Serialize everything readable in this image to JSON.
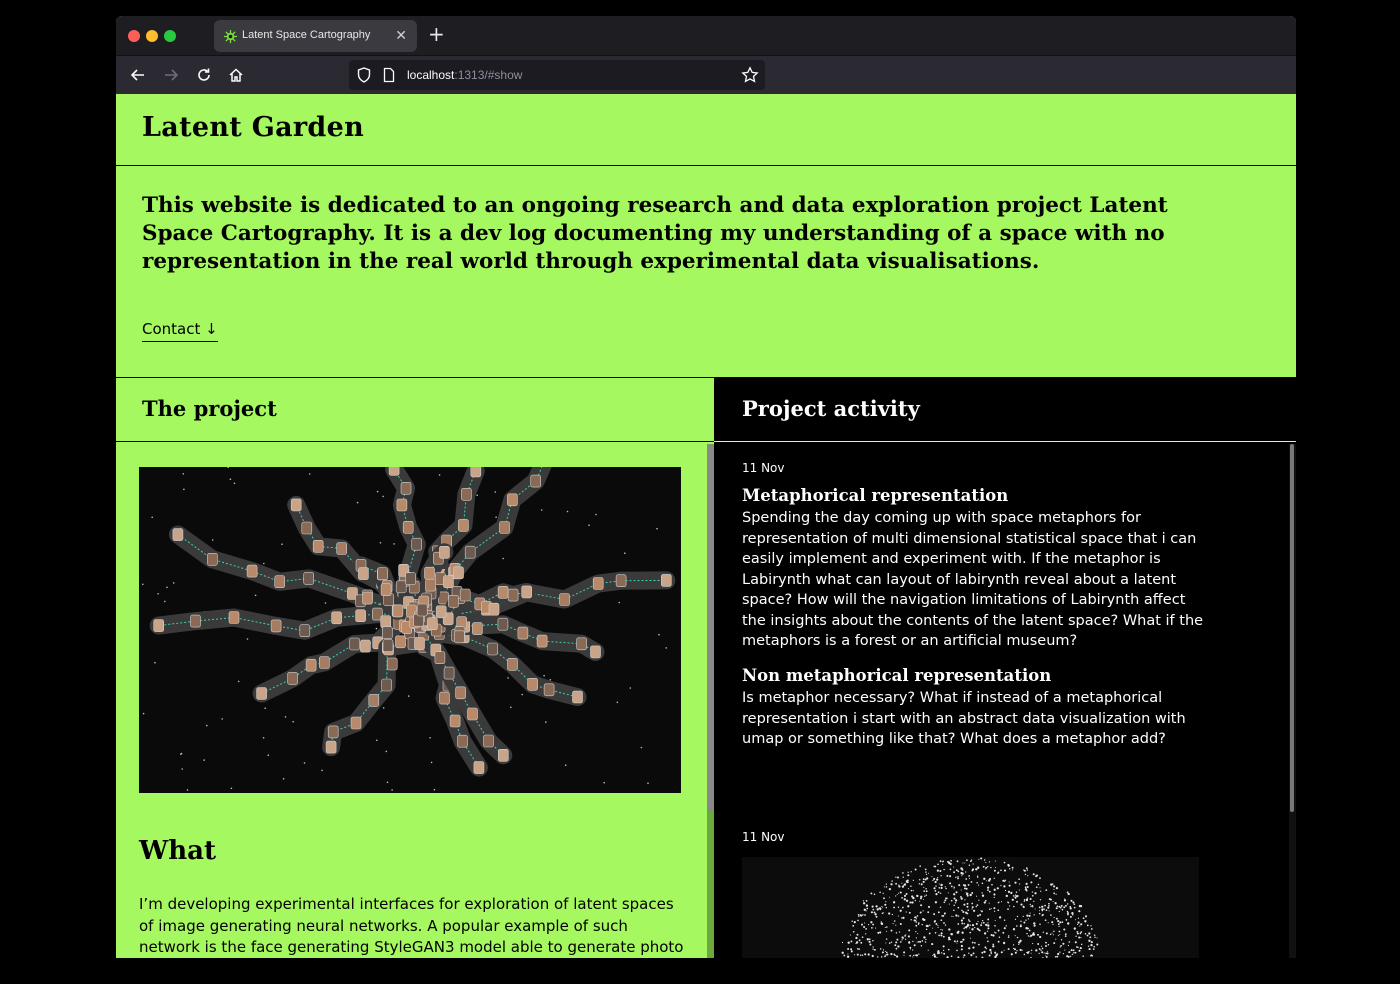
{
  "browser": {
    "tab_title": "Latent Space Cartography",
    "url_host": "localhost",
    "url_rest": ":1313/#show"
  },
  "site": {
    "title": "Latent Garden",
    "intro": "This website is dedicated to an ongoing research and data exploration project Latent Space Cartography. It is a dev log documenting my understanding of a space with no representation in the real world through experimental data visualisations.",
    "contact_link": "Contact ↓"
  },
  "project": {
    "heading": "The project",
    "what_heading": "What",
    "what_text": "I’m developing experimental interfaces for exploration of latent spaces of image generating neural networks. A popular example of such network is the face generating StyleGAN3 model able to generate photo realistic"
  },
  "activity": {
    "heading": "Project activity",
    "entries": [
      {
        "date": "11 Nov",
        "items": [
          {
            "title": "Metaphorical representation",
            "body": "Spending the day coming up with space metaphors for representation of multi dimensional statistical space that i can easily implement and experiment with. If the metaphor is Labirynth what can layout of labirynth reveal about a latent space? How will the navigation limitations of Labirynth affect the insights about the contents of the latent space? What if the metaphors is a forest or an artificial museum?"
          },
          {
            "title": "Non metaphorical representation",
            "body": "Is metaphor necessary? What if instead of a metaphorical representation i start with an abstract data visualization with umap or something like that? What does a metaphor add?"
          }
        ]
      },
      {
        "date": "11 Nov"
      }
    ]
  },
  "colors": {
    "page_bg": "#a6f860",
    "activity_bg": "#000000",
    "browser_chrome": "#2b2a33"
  }
}
